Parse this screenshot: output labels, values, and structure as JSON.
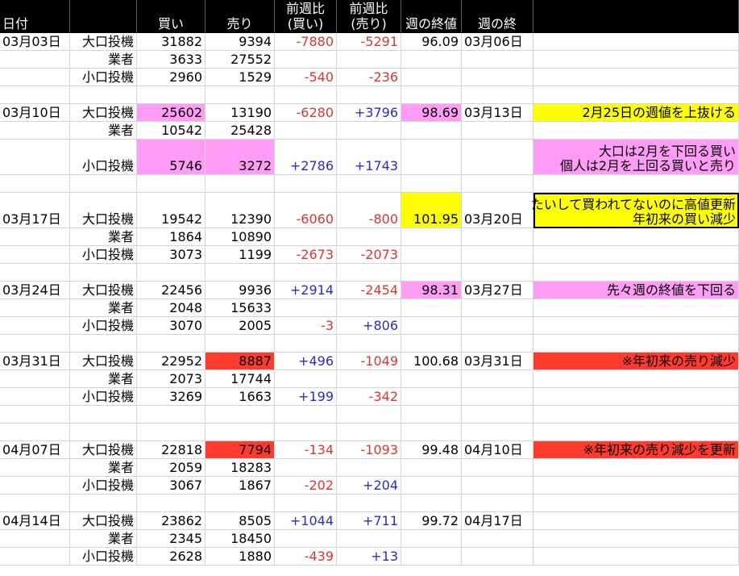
{
  "headers": [
    "日付",
    "",
    "買い",
    "売り",
    "前週比\n(買い)",
    "前週比\n(売り)",
    "週の終値",
    "週の終",
    ""
  ],
  "rows": [
    {
      "c": [
        "03月03日",
        "大口投機",
        "31882",
        "9394",
        "-7880",
        "-5291",
        "96.09",
        "03月06日",
        ""
      ]
    },
    {
      "c": [
        "",
        "業者",
        "3633",
        "27552",
        "",
        "",
        "",
        "",
        ""
      ]
    },
    {
      "c": [
        "",
        "小口投機",
        "2960",
        "1529",
        "-540",
        "-236",
        "",
        "",
        ""
      ]
    },
    {
      "c": [
        "",
        "",
        "",
        "",
        "",
        "",
        "",
        "",
        ""
      ]
    },
    {
      "c": [
        "03月10日",
        "大口投機",
        "25602",
        "13190",
        "-6280",
        "+3796",
        "98.69",
        "03月13日",
        "2月25日の週値を上抜ける"
      ]
    },
    {
      "c": [
        "",
        "業者",
        "10542",
        "25428",
        "",
        "",
        "",
        "",
        ""
      ]
    },
    {
      "c": [
        "",
        "小口投機",
        "5746",
        "3272",
        "+2786",
        "+1743",
        "",
        "",
        "大口は2月を下回る買い\n個人は2月を上回る買いと売り"
      ]
    },
    {
      "c": [
        "",
        "",
        "",
        "",
        "",
        "",
        "",
        "",
        ""
      ]
    },
    {
      "c": [
        "03月17日",
        "大口投機",
        "19542",
        "12390",
        "-6060",
        "-800",
        "101.95",
        "03月20日",
        "たいして買われてないのに高値更新\n年初来の買い減少"
      ]
    },
    {
      "c": [
        "",
        "業者",
        "1864",
        "10890",
        "",
        "",
        "",
        "",
        ""
      ]
    },
    {
      "c": [
        "",
        "小口投機",
        "3073",
        "1199",
        "-2673",
        "-2073",
        "",
        "",
        ""
      ]
    },
    {
      "c": [
        "",
        "",
        "",
        "",
        "",
        "",
        "",
        "",
        ""
      ]
    },
    {
      "c": [
        "03月24日",
        "大口投機",
        "22456",
        "9936",
        "+2914",
        "-2454",
        "98.31",
        "03月27日",
        "先々週の終値を下回る"
      ]
    },
    {
      "c": [
        "",
        "業者",
        "2048",
        "15633",
        "",
        "",
        "",
        "",
        ""
      ]
    },
    {
      "c": [
        "",
        "小口投機",
        "3070",
        "2005",
        "-3",
        "+806",
        "",
        "",
        ""
      ]
    },
    {
      "c": [
        "",
        "",
        "",
        "",
        "",
        "",
        "",
        "",
        ""
      ]
    },
    {
      "c": [
        "03月31日",
        "大口投機",
        "22952",
        "8887",
        "+496",
        "-1049",
        "100.68",
        "03月31日",
        "※年初来の売り減少"
      ]
    },
    {
      "c": [
        "",
        "業者",
        "2073",
        "17744",
        "",
        "",
        "",
        "",
        ""
      ]
    },
    {
      "c": [
        "",
        "小口投機",
        "3269",
        "1663",
        "+199",
        "-342",
        "",
        "",
        ""
      ]
    },
    {
      "c": [
        "",
        "",
        "",
        "",
        "",
        "",
        "",
        "",
        ""
      ]
    },
    {
      "c": [
        "",
        "",
        "",
        "",
        "",
        "",
        "",
        "",
        ""
      ]
    },
    {
      "c": [
        "04月07日",
        "大口投機",
        "22818",
        "7794",
        "-134",
        "-1093",
        "99.48",
        "04月10日",
        "※年初来の売り減少を更新"
      ]
    },
    {
      "c": [
        "",
        "業者",
        "2059",
        "18283",
        "",
        "",
        "",
        "",
        ""
      ]
    },
    {
      "c": [
        "",
        "小口投機",
        "3067",
        "1867",
        "-202",
        "+204",
        "",
        "",
        ""
      ]
    },
    {
      "c": [
        "",
        "",
        "",
        "",
        "",
        "",
        "",
        "",
        ""
      ]
    },
    {
      "c": [
        "04月14日",
        "大口投機",
        "23862",
        "8505",
        "+1044",
        "+711",
        "99.72",
        "04月17日",
        ""
      ]
    },
    {
      "c": [
        "",
        "業者",
        "2345",
        "18450",
        "",
        "",
        "",
        "",
        ""
      ]
    },
    {
      "c": [
        "",
        "小口投機",
        "2628",
        "1880",
        "-439",
        "+13",
        "",
        "",
        ""
      ]
    }
  ],
  "highlights": {
    "pink": "#ff9cf5",
    "yellow": "#ffff00",
    "red": "#ff3b30",
    "negative_text": "#e0352b",
    "positive_text": "#2a2ad0"
  }
}
